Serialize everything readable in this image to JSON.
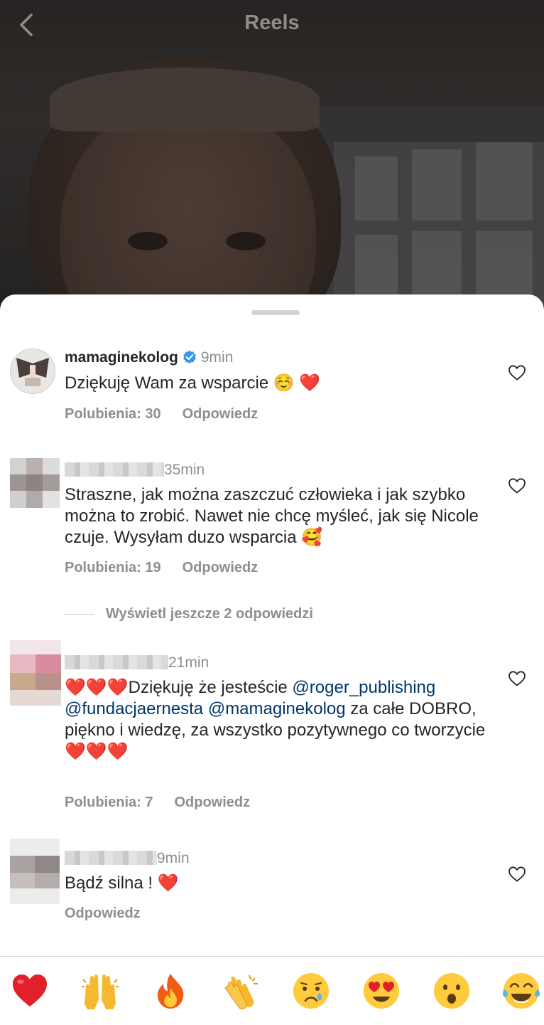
{
  "header": {
    "title": "Reels",
    "back_icon": "chevron-left-icon"
  },
  "comments": [
    {
      "username": "mamaginekolog",
      "verified": true,
      "time": "9min",
      "text": "Dziękuję Wam za wsparcie ☺️ ❤️",
      "likes": "Polubienia: 30",
      "reply": "Odpowiedz"
    },
    {
      "time": "35min",
      "text": "Straszne, jak można zaszczuć człowieka i jak szybko można to zrobić. Nawet nie chcę myśleć, jak się Nicole czuje. Wysyłam duzo wsparcia 🥰",
      "likes": "Polubienia: 19",
      "reply": "Odpowiedz"
    },
    {
      "time": "21min",
      "text_start": "❤️❤️❤️Dziękuję że jesteście",
      "mention1": "@roger_publishing",
      "mention2": "@fundacjaernesta",
      "mention3": "@mamaginekolog",
      "text_end": " za całe DOBRO, piękno i wiedzę, za wszystko pozytywnego co tworzycie ❤️❤️❤️",
      "likes": "Polubienia: 7",
      "reply": "Odpowiedz"
    },
    {
      "time": "9min",
      "text": "Bądź silna ! ❤️",
      "reply": "Odpowiedz"
    }
  ],
  "view_replies": "Wyświetl jeszcze 2 odpowiedzi",
  "emoji_bar": [
    "❤️",
    "🙌",
    "🔥",
    "👏",
    "😢",
    "😍",
    "😮",
    "😂"
  ],
  "colors": {
    "verified": "#3897f0",
    "heart": "#ed1c24",
    "mention": "#00376b",
    "secondary_text": "#8e8e8e"
  }
}
